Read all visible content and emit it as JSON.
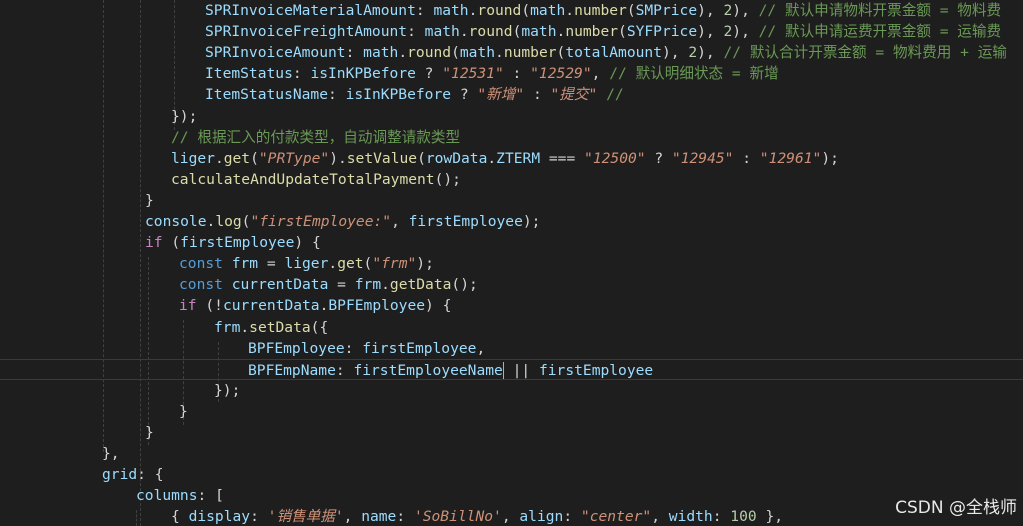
{
  "editor": {
    "lines": [
      {
        "indent": 205,
        "tokens": [
          {
            "t": "SPRInvoiceMaterialAmount",
            "c": "prop"
          },
          {
            "t": ": ",
            "c": "punc"
          },
          {
            "t": "math",
            "c": "var"
          },
          {
            "t": ".",
            "c": "punc"
          },
          {
            "t": "round",
            "c": "fn"
          },
          {
            "t": "(",
            "c": "punc"
          },
          {
            "t": "math",
            "c": "var"
          },
          {
            "t": ".",
            "c": "punc"
          },
          {
            "t": "number",
            "c": "fn"
          },
          {
            "t": "(",
            "c": "punc"
          },
          {
            "t": "SMPrice",
            "c": "var"
          },
          {
            "t": "), ",
            "c": "punc"
          },
          {
            "t": "2",
            "c": "num"
          },
          {
            "t": "), ",
            "c": "punc"
          },
          {
            "t": "// 默认申请物料开票金额 = 物料费",
            "c": "cmt"
          }
        ]
      },
      {
        "indent": 205,
        "tokens": [
          {
            "t": "SPRInvoiceFreightAmount",
            "c": "prop"
          },
          {
            "t": ": ",
            "c": "punc"
          },
          {
            "t": "math",
            "c": "var"
          },
          {
            "t": ".",
            "c": "punc"
          },
          {
            "t": "round",
            "c": "fn"
          },
          {
            "t": "(",
            "c": "punc"
          },
          {
            "t": "math",
            "c": "var"
          },
          {
            "t": ".",
            "c": "punc"
          },
          {
            "t": "number",
            "c": "fn"
          },
          {
            "t": "(",
            "c": "punc"
          },
          {
            "t": "SYFPrice",
            "c": "var"
          },
          {
            "t": "), ",
            "c": "punc"
          },
          {
            "t": "2",
            "c": "num"
          },
          {
            "t": "), ",
            "c": "punc"
          },
          {
            "t": "// 默认申请运费开票金额 = 运输费",
            "c": "cmt"
          }
        ]
      },
      {
        "indent": 205,
        "tokens": [
          {
            "t": "SPRInvoiceAmount",
            "c": "prop"
          },
          {
            "t": ": ",
            "c": "punc"
          },
          {
            "t": "math",
            "c": "var"
          },
          {
            "t": ".",
            "c": "punc"
          },
          {
            "t": "round",
            "c": "fn"
          },
          {
            "t": "(",
            "c": "punc"
          },
          {
            "t": "math",
            "c": "var"
          },
          {
            "t": ".",
            "c": "punc"
          },
          {
            "t": "number",
            "c": "fn"
          },
          {
            "t": "(",
            "c": "punc"
          },
          {
            "t": "totalAmount",
            "c": "var"
          },
          {
            "t": "), ",
            "c": "punc"
          },
          {
            "t": "2",
            "c": "num"
          },
          {
            "t": "), ",
            "c": "punc"
          },
          {
            "t": "// 默认合计开票金额 = 物料费用 + 运输",
            "c": "cmt"
          }
        ]
      },
      {
        "indent": 205,
        "tokens": [
          {
            "t": "ItemStatus",
            "c": "prop"
          },
          {
            "t": ": ",
            "c": "punc"
          },
          {
            "t": "isInKPBefore",
            "c": "var"
          },
          {
            "t": " ? ",
            "c": "op"
          },
          {
            "t": "\"12531\"",
            "c": "str"
          },
          {
            "t": " : ",
            "c": "op"
          },
          {
            "t": "\"12529\"",
            "c": "str"
          },
          {
            "t": ", ",
            "c": "punc"
          },
          {
            "t": "// 默认明细状态 = 新增",
            "c": "cmt"
          }
        ]
      },
      {
        "indent": 205,
        "tokens": [
          {
            "t": "ItemStatusName",
            "c": "prop"
          },
          {
            "t": ": ",
            "c": "punc"
          },
          {
            "t": "isInKPBefore",
            "c": "var"
          },
          {
            "t": " ? ",
            "c": "op"
          },
          {
            "t": "\"新增\"",
            "c": "str"
          },
          {
            "t": " : ",
            "c": "op"
          },
          {
            "t": "\"提交\"",
            "c": "str"
          },
          {
            "t": " //",
            "c": "cmt"
          }
        ]
      },
      {
        "indent": 171,
        "tokens": [
          {
            "t": "});",
            "c": "punc"
          }
        ]
      },
      {
        "indent": 171,
        "tokens": [
          {
            "t": "// 根据汇入的付款类型，自动调整请款类型",
            "c": "cmt"
          }
        ]
      },
      {
        "indent": 171,
        "tokens": [
          {
            "t": "liger",
            "c": "var"
          },
          {
            "t": ".",
            "c": "punc"
          },
          {
            "t": "get",
            "c": "fn"
          },
          {
            "t": "(",
            "c": "punc"
          },
          {
            "t": "\"PRType\"",
            "c": "str"
          },
          {
            "t": ").",
            "c": "punc"
          },
          {
            "t": "setValue",
            "c": "fn"
          },
          {
            "t": "(",
            "c": "punc"
          },
          {
            "t": "rowData",
            "c": "var"
          },
          {
            "t": ".",
            "c": "punc"
          },
          {
            "t": "ZTERM",
            "c": "var"
          },
          {
            "t": " === ",
            "c": "op"
          },
          {
            "t": "\"12500\"",
            "c": "str"
          },
          {
            "t": " ? ",
            "c": "op"
          },
          {
            "t": "\"12945\"",
            "c": "str"
          },
          {
            "t": " : ",
            "c": "op"
          },
          {
            "t": "\"12961\"",
            "c": "str"
          },
          {
            "t": ");",
            "c": "punc"
          }
        ]
      },
      {
        "indent": 171,
        "tokens": [
          {
            "t": "calculateAndUpdateTotalPayment",
            "c": "fn"
          },
          {
            "t": "();",
            "c": "punc"
          }
        ]
      },
      {
        "indent": 145,
        "tokens": [
          {
            "t": "}",
            "c": "punc"
          }
        ]
      },
      {
        "indent": 145,
        "tokens": [
          {
            "t": "console",
            "c": "var"
          },
          {
            "t": ".",
            "c": "punc"
          },
          {
            "t": "log",
            "c": "fn"
          },
          {
            "t": "(",
            "c": "punc"
          },
          {
            "t": "\"firstEmployee:\"",
            "c": "str"
          },
          {
            "t": ", ",
            "c": "punc"
          },
          {
            "t": "firstEmployee",
            "c": "var"
          },
          {
            "t": ");",
            "c": "punc"
          }
        ]
      },
      {
        "indent": 145,
        "tokens": [
          {
            "t": "if",
            "c": "ctrl"
          },
          {
            "t": " (",
            "c": "punc"
          },
          {
            "t": "firstEmployee",
            "c": "var"
          },
          {
            "t": ") {",
            "c": "punc"
          }
        ]
      },
      {
        "indent": 179,
        "tokens": [
          {
            "t": "const",
            "c": "kw"
          },
          {
            "t": " ",
            "c": "punc"
          },
          {
            "t": "frm",
            "c": "var"
          },
          {
            "t": " = ",
            "c": "op"
          },
          {
            "t": "liger",
            "c": "var"
          },
          {
            "t": ".",
            "c": "punc"
          },
          {
            "t": "get",
            "c": "fn"
          },
          {
            "t": "(",
            "c": "punc"
          },
          {
            "t": "\"frm\"",
            "c": "str"
          },
          {
            "t": ");",
            "c": "punc"
          }
        ]
      },
      {
        "indent": 179,
        "tokens": [
          {
            "t": "const",
            "c": "kw"
          },
          {
            "t": " ",
            "c": "punc"
          },
          {
            "t": "currentData",
            "c": "var"
          },
          {
            "t": " = ",
            "c": "op"
          },
          {
            "t": "frm",
            "c": "var"
          },
          {
            "t": ".",
            "c": "punc"
          },
          {
            "t": "getData",
            "c": "fn"
          },
          {
            "t": "();",
            "c": "punc"
          }
        ]
      },
      {
        "indent": 179,
        "tokens": [
          {
            "t": "if",
            "c": "ctrl"
          },
          {
            "t": " (!",
            "c": "punc"
          },
          {
            "t": "currentData",
            "c": "var"
          },
          {
            "t": ".",
            "c": "punc"
          },
          {
            "t": "BPFEmployee",
            "c": "var"
          },
          {
            "t": ") {",
            "c": "punc"
          }
        ]
      },
      {
        "indent": 214,
        "tokens": [
          {
            "t": "frm",
            "c": "var"
          },
          {
            "t": ".",
            "c": "punc"
          },
          {
            "t": "setData",
            "c": "fn"
          },
          {
            "t": "({",
            "c": "punc"
          }
        ]
      },
      {
        "indent": 248,
        "tokens": [
          {
            "t": "BPFEmployee",
            "c": "prop"
          },
          {
            "t": ": ",
            "c": "punc"
          },
          {
            "t": "firstEmployee",
            "c": "var"
          },
          {
            "t": ",",
            "c": "punc"
          }
        ]
      },
      {
        "indent": 248,
        "current": true,
        "tokens": [
          {
            "t": "BPFEmpName",
            "c": "prop"
          },
          {
            "t": ": ",
            "c": "punc"
          },
          {
            "t": "firstEmployeeName",
            "c": "var"
          },
          {
            "t": " || ",
            "c": "op"
          },
          {
            "t": "firstEmployee",
            "c": "var"
          }
        ]
      },
      {
        "indent": 214,
        "tokens": [
          {
            "t": "});",
            "c": "punc"
          }
        ]
      },
      {
        "indent": 179,
        "tokens": [
          {
            "t": "}",
            "c": "punc"
          }
        ]
      },
      {
        "indent": 145,
        "tokens": [
          {
            "t": "}",
            "c": "punc"
          }
        ]
      },
      {
        "indent": 102,
        "tokens": [
          {
            "t": "},",
            "c": "punc"
          }
        ]
      },
      {
        "indent": 102,
        "tokens": [
          {
            "t": "grid",
            "c": "prop"
          },
          {
            "t": ": {",
            "c": "punc"
          }
        ]
      },
      {
        "indent": 136,
        "tokens": [
          {
            "t": "columns",
            "c": "prop"
          },
          {
            "t": ": [",
            "c": "punc"
          }
        ]
      },
      {
        "indent": 171,
        "tokens": [
          {
            "t": "{ ",
            "c": "punc"
          },
          {
            "t": "display",
            "c": "prop"
          },
          {
            "t": ": ",
            "c": "punc"
          },
          {
            "t": "'销售单据'",
            "c": "str"
          },
          {
            "t": ", ",
            "c": "punc"
          },
          {
            "t": "name",
            "c": "prop"
          },
          {
            "t": ": ",
            "c": "punc"
          },
          {
            "t": "'SoBillNo'",
            "c": "str"
          },
          {
            "t": ", ",
            "c": "punc"
          },
          {
            "t": "align",
            "c": "prop"
          },
          {
            "t": ": ",
            "c": "punc"
          },
          {
            "t": "\"center\"",
            "c": "str"
          },
          {
            "t": ", ",
            "c": "punc"
          },
          {
            "t": "width",
            "c": "prop"
          },
          {
            "t": ": ",
            "c": "punc"
          },
          {
            "t": "100",
            "c": "num"
          },
          {
            "t": " },",
            "c": "punc"
          }
        ]
      }
    ]
  },
  "watermark": {
    "text": "CSDN @全栈师"
  }
}
